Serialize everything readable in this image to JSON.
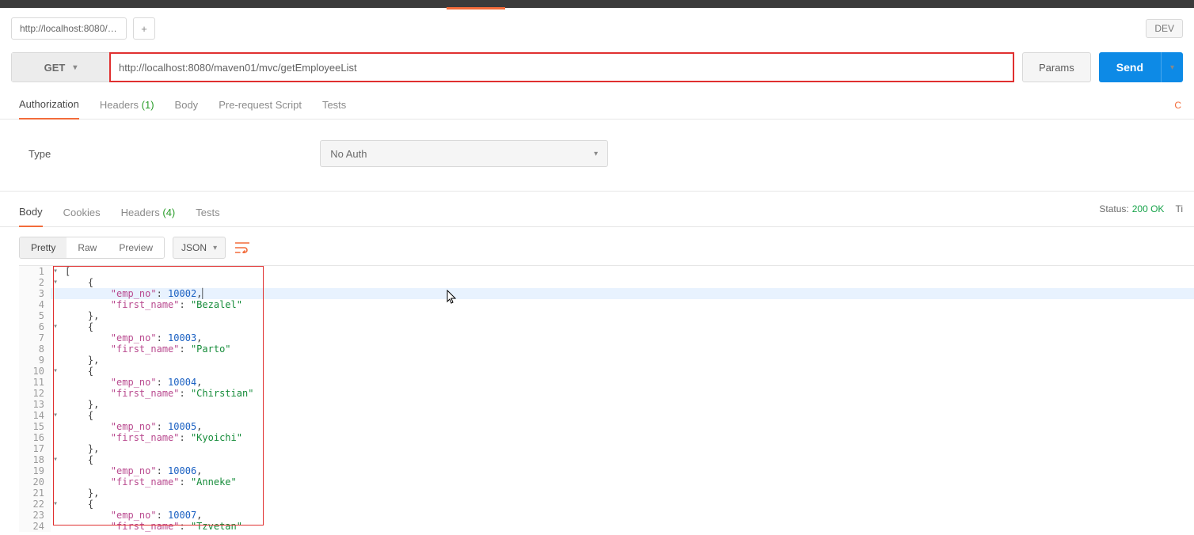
{
  "topTab": {
    "label": "http://localhost:8080/ma",
    "add": "+"
  },
  "env": "DEV",
  "request": {
    "method": "GET",
    "url": "http://localhost:8080/maven01/mvc/getEmployeeList",
    "params": "Params",
    "send": "Send"
  },
  "reqTabs": {
    "auth": "Authorization",
    "headers": "Headers",
    "headersCount": "(1)",
    "body": "Body",
    "prescript": "Pre-request Script",
    "tests": "Tests"
  },
  "auth": {
    "typeLabel": "Type",
    "selected": "No Auth"
  },
  "respTabs": {
    "body": "Body",
    "cookies": "Cookies",
    "headers": "Headers",
    "headersCount": "(4)",
    "tests": "Tests"
  },
  "status": {
    "label": "Status:",
    "value": "200 OK",
    "timeLabel": "Ti"
  },
  "views": {
    "pretty": "Pretty",
    "raw": "Raw",
    "preview": "Preview",
    "format": "JSON"
  },
  "response": [
    {
      "emp_no": 10002,
      "first_name": "Bezalel"
    },
    {
      "emp_no": 10003,
      "first_name": "Parto"
    },
    {
      "emp_no": 10004,
      "first_name": "Chirstian"
    },
    {
      "emp_no": 10005,
      "first_name": "Kyoichi"
    },
    {
      "emp_no": 10006,
      "first_name": "Anneke"
    },
    {
      "emp_no": 10007,
      "first_name": "Tzvetan"
    }
  ]
}
